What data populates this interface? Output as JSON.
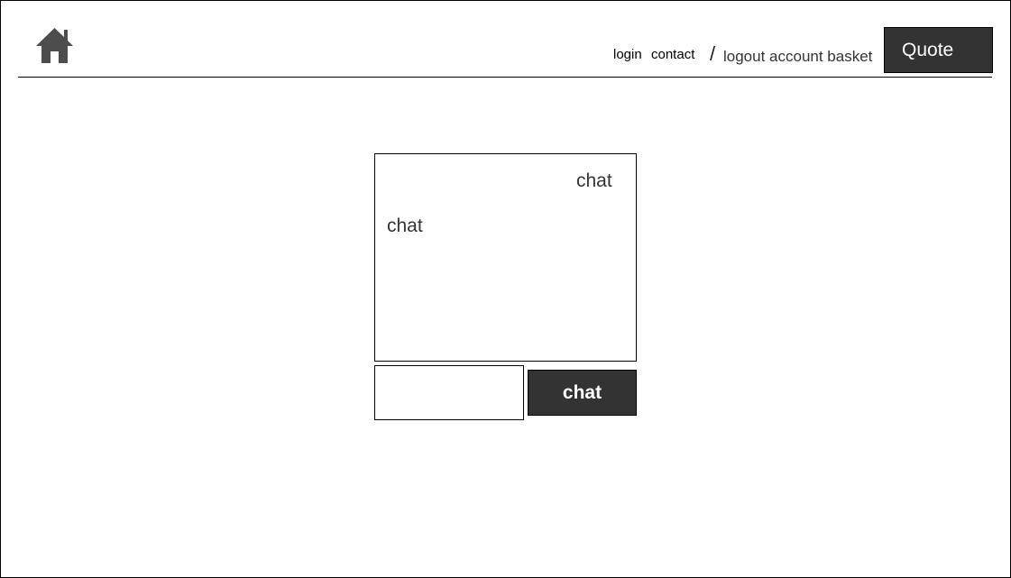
{
  "header": {
    "home_icon": "home-icon",
    "nav": {
      "login": "login",
      "contact": "contact",
      "separator": "/",
      "account_links": "logout account basket"
    },
    "quote_label": "Quote"
  },
  "chat": {
    "messages": [
      {
        "side": "right",
        "text": "chat"
      },
      {
        "side": "left",
        "text": "chat"
      }
    ],
    "input_value": "",
    "send_label": "chat"
  },
  "colors": {
    "button_bg": "#333333",
    "button_text": "#ffffff",
    "border": "#000000",
    "icon": "#4d4d4d"
  }
}
